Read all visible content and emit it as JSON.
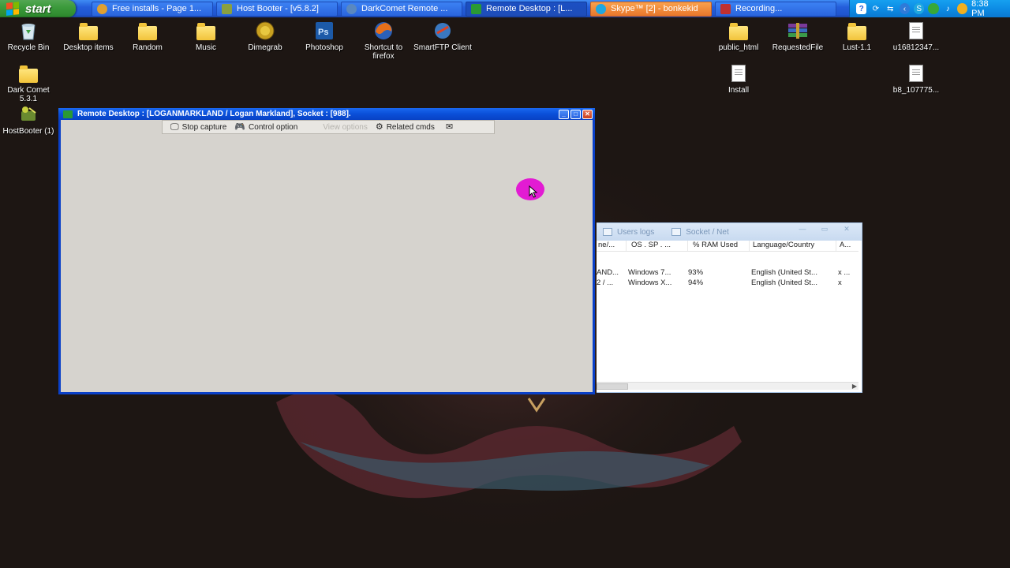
{
  "taskbar": {
    "start_label": "start",
    "buttons": [
      {
        "label": "Free installs - Page 1...",
        "icon": "chrome-icon",
        "color": "#e0a030"
      },
      {
        "label": "Host Booter - [v5.8.2]",
        "icon": "hostbooter-icon",
        "color": "#8aa040"
      },
      {
        "label": "DarkComet Remote ...",
        "icon": "darkcomet-icon",
        "color": "#5a88c0"
      },
      {
        "label": "Remote Desktop : [L...",
        "icon": "remote-desktop-icon",
        "color": "#2a9a35"
      },
      {
        "label": "Skype™ [2] - bonkekid",
        "icon": "skype-icon",
        "color": "#1fa7e0"
      },
      {
        "label": "Recording...",
        "icon": "recording-icon",
        "color": "#c03030"
      }
    ],
    "clock": "8:38 PM"
  },
  "desktop": {
    "left_icons": [
      {
        "label": "Recycle Bin",
        "icon": "recycle-bin-icon"
      },
      {
        "label": "Desktop items",
        "icon": "folder-icon"
      },
      {
        "label": "Random",
        "icon": "folder-icon"
      },
      {
        "label": "Music",
        "icon": "folder-icon"
      },
      {
        "label": "Dimegrab",
        "icon": "dimegrab-icon"
      },
      {
        "label": "Photoshop",
        "icon": "photoshop-icon"
      },
      {
        "label": "Shortcut to firefox",
        "icon": "firefox-icon"
      },
      {
        "label": "SmartFTP Client",
        "icon": "smartftp-icon"
      },
      {
        "label": "Dark Comet 5.3.1",
        "icon": "folder-icon"
      },
      {
        "label": "HostBooter (1)",
        "icon": "hostbooter-icon"
      }
    ],
    "right_icons": [
      {
        "label": "public_html",
        "icon": "folder-icon"
      },
      {
        "label": "RequestedFile",
        "icon": "winrar-icon"
      },
      {
        "label": "Lust-1.1",
        "icon": "folder-icon"
      },
      {
        "label": "u16812347...",
        "icon": "document-icon"
      },
      {
        "label": "Install",
        "icon": "document-icon"
      },
      {
        "label": "b8_107775...",
        "icon": "document-icon"
      }
    ]
  },
  "remote_desktop": {
    "title": "Remote Desktop : [LOGANMARKLAND / Logan Markland], Socket : [988].",
    "toolbar": {
      "stop_capture": "Stop capture",
      "control_option": "Control option",
      "view_options": "View options",
      "related_cmds": "Related cmds"
    }
  },
  "darkcomet": {
    "tabs": [
      "Users logs",
      "Socket / Net"
    ],
    "columns": [
      "ne/...",
      "OS . SP . ...",
      "% RAM Used",
      "Language/Country",
      "A..."
    ],
    "rows": [
      [
        "AND...",
        "Windows 7...",
        "93%",
        "English (United St...",
        "x ..."
      ],
      [
        "2 / ...",
        "Windows X...",
        "94%",
        "English (United St...",
        "x"
      ]
    ]
  }
}
